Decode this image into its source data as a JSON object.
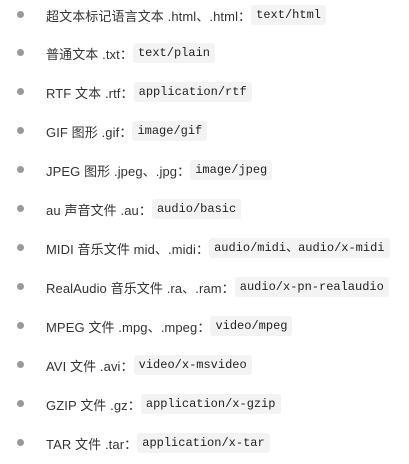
{
  "items": [
    {
      "label": "超文本标记语言文本 .html、.html：",
      "code": "text/html"
    },
    {
      "label": "普通文本 .txt：",
      "code": "text/plain"
    },
    {
      "label": "RTF 文本 .rtf：",
      "code": "application/rtf"
    },
    {
      "label": "GIF 图形 .gif：",
      "code": "image/gif"
    },
    {
      "label": "JPEG 图形 .jpeg、.jpg：",
      "code": "image/jpeg"
    },
    {
      "label": "au 声音文件 .au：",
      "code": "audio/basic"
    },
    {
      "label": "MIDI 音乐文件 mid、.midi：",
      "code": "audio/midi、audio/x-midi"
    },
    {
      "label": "RealAudio 音乐文件 .ra、.ram：",
      "code": "audio/x-pn-realaudio"
    },
    {
      "label": "MPEG 文件 .mpg、.mpeg：",
      "code": "video/mpeg"
    },
    {
      "label": "AVI 文件 .avi：",
      "code": "video/x-msvideo"
    },
    {
      "label": "GZIP 文件 .gz：",
      "code": "application/x-gzip"
    },
    {
      "label": "TAR 文件 .tar：",
      "code": "application/x-tar"
    }
  ]
}
